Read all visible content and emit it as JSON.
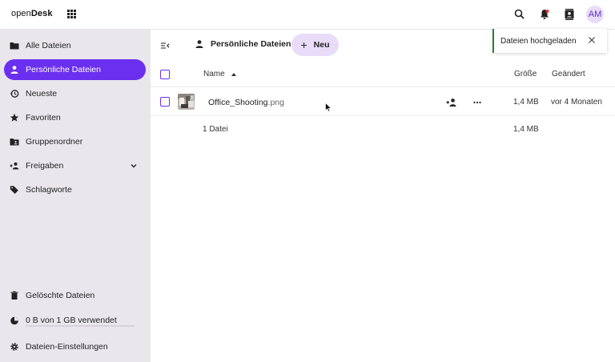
{
  "app": {
    "brand_regular": "open",
    "brand_bold": "Desk",
    "avatar_initials": "AM"
  },
  "topbar": {
    "icons": [
      "apps-grid-icon",
      "search-icon",
      "notifications-icon",
      "contacts-icon"
    ]
  },
  "sidebar": {
    "items": [
      {
        "label": "Alle Dateien",
        "icon": "folder-icon"
      },
      {
        "label": "Persönliche Dateien",
        "icon": "person-icon",
        "active": true
      },
      {
        "label": "Neueste",
        "icon": "history-icon"
      },
      {
        "label": "Favoriten",
        "icon": "star-icon"
      },
      {
        "label": "Gruppenordner",
        "icon": "group-folder-icon"
      },
      {
        "label": "Freigaben",
        "icon": "share-icon"
      },
      {
        "label": "Schlagworte",
        "icon": "tag-icon"
      }
    ],
    "bottom": {
      "trash": "Gelöschte Dateien",
      "quota": "0 B von 1 GB verwendet",
      "quota_fraction": 0,
      "settings": "Dateien-Einstellungen"
    }
  },
  "main": {
    "breadcrumb": "Persönliche Dateien",
    "new_button": "Neu",
    "columns": {
      "name": "Name",
      "size": "Größe",
      "modified": "Geändert"
    },
    "files": [
      {
        "basename": "Office_Shooting",
        "extension": ".png",
        "size": "1,4 MB",
        "modified": "vor 4 Monaten"
      }
    ],
    "summary": {
      "count": "1 Datei",
      "size": "1,4 MB"
    }
  },
  "toast": {
    "message": "Dateien hochgeladen"
  },
  "colors": {
    "accent": "#6b2ff0",
    "sidebar_bg": "#e9e7ec",
    "pill_bg": "#e8dcf8",
    "toast_border": "#2e7d32"
  }
}
